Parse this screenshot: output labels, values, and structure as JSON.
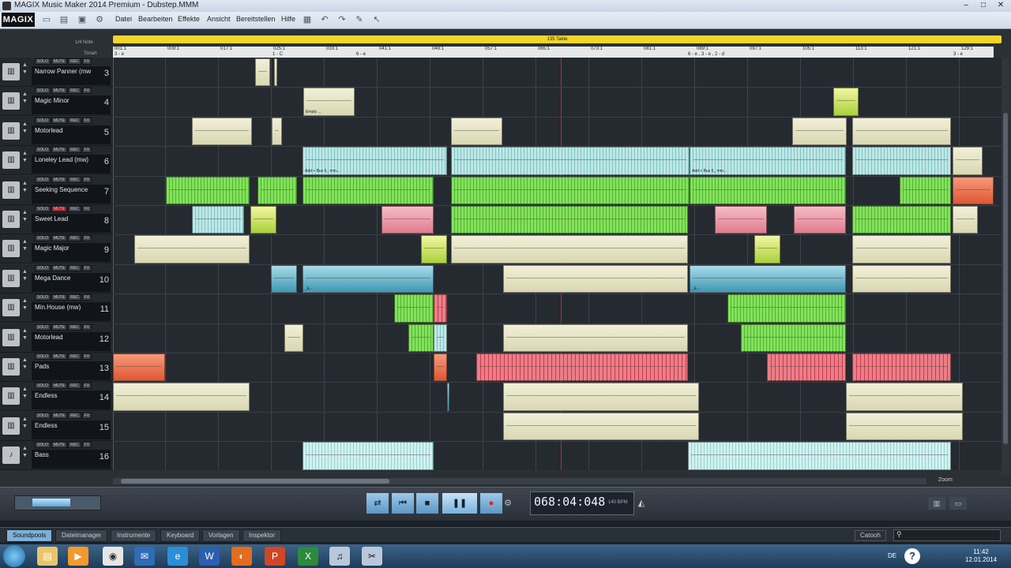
{
  "window": {
    "title": "MAGIX Music Maker 2014 Premium - Dubstep.MMM",
    "controls": [
      "–",
      "□",
      "✕"
    ]
  },
  "logo": "MAGIX",
  "menu": [
    "Datei",
    "Bearbeiten",
    "Effekte",
    "Ansicht",
    "Bereitstellen",
    "Hilfe"
  ],
  "ruler": {
    "length_label": "135 Takte",
    "quantize": "1/4 Note",
    "tempo_label": "Tonart",
    "bars": [
      "001:1",
      "009:1",
      "017:1",
      "025:1",
      "033:1",
      "041:1",
      "049:1",
      "057:1",
      "065:1",
      "073:1",
      "081:1",
      "089:1",
      "097:1",
      "105:1",
      "113:1",
      "121:1",
      "129:1"
    ],
    "chords": [
      "3 - e",
      "1 - C",
      "3",
      "6 - e",
      "6 - e , 3 - e , 2 - d",
      "3 - e"
    ]
  },
  "track_buttons": {
    "solo": "SOLO",
    "mute": "MUTE",
    "rec": "REC",
    "fx": "FX"
  },
  "tracks": [
    {
      "name": "Narrow Panner (mw",
      "num": "3"
    },
    {
      "name": "Magic Minor",
      "num": "4"
    },
    {
      "name": "Motorlead",
      "num": "5"
    },
    {
      "name": "Loneley Lead (mw)",
      "num": "6"
    },
    {
      "name": "Seeking Sequence",
      "num": "7"
    },
    {
      "name": "Sweet Lead",
      "num": "8"
    },
    {
      "name": "Magic Major",
      "num": "9"
    },
    {
      "name": "Mega Dance",
      "num": "10"
    },
    {
      "name": "Min.House (mw)",
      "num": "11"
    },
    {
      "name": "Motorlead",
      "num": "12"
    },
    {
      "name": "Pads",
      "num": "13"
    },
    {
      "name": "Endless",
      "num": "14"
    },
    {
      "name": "Endless",
      "num": "15"
    },
    {
      "name": "Bass",
      "num": "16"
    }
  ],
  "clip_captions": {
    "empty": "Empty ...",
    "add": "Add + Bus 6_ mm...",
    "e": "_E..."
  },
  "transport": {
    "time": "068:04:048",
    "bpm": "140 BPM",
    "buttons": [
      "loop",
      "to-start",
      "stop",
      "pause",
      "record",
      "settings"
    ]
  },
  "tabs": [
    "Soundpools",
    "Dateimanager",
    "Instrumente",
    "Keyboard",
    "Vorlagen",
    "Inspektor"
  ],
  "catooh": "Catooh",
  "zoom": "Zoom",
  "taskbar": {
    "lang": "DE",
    "time": "11:42",
    "date": "12.01.2014",
    "help": "?"
  }
}
